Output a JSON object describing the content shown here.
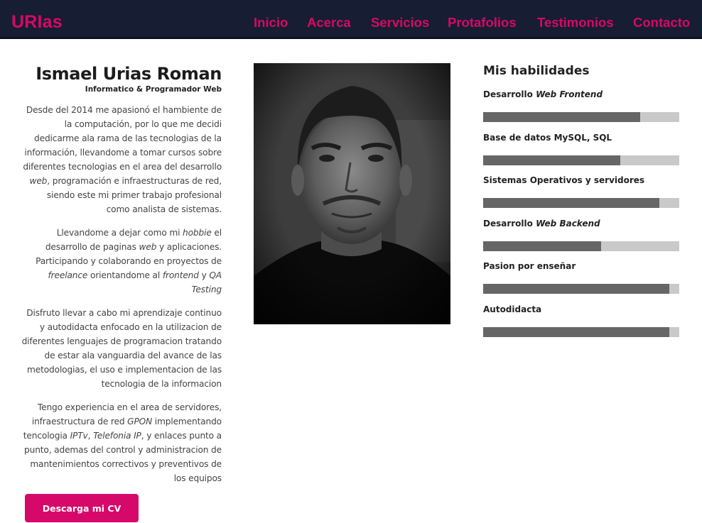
{
  "brand": "URIas",
  "nav": {
    "items": [
      {
        "label": "Inicio"
      },
      {
        "label": "Acerca"
      },
      {
        "label": "Servicios"
      },
      {
        "label": "Protafolios"
      },
      {
        "label": "Testimonios"
      },
      {
        "label": "Contacto"
      }
    ]
  },
  "about": {
    "name": "Ismael Urias Roman",
    "subtitle": "Informatico & Programador Web",
    "paragraphs": [
      [
        {
          "t": "Desde del 2014 me apasionó el hambiente de la computación, por lo que me decidi dedicarme ala rama de las tecnologias de la información, llevandome a tomar cursos sobre diferentes tecnologias en el area del desarrollo "
        },
        {
          "t": "web",
          "em": true
        },
        {
          "t": ", programación e infraestructuras de red, siendo este mi primer trabajo profesional como analista de sistemas."
        }
      ],
      [
        {
          "t": "Llevandome a dejar como mi "
        },
        {
          "t": "hobbie",
          "em": true
        },
        {
          "t": " el desarrollo de paginas "
        },
        {
          "t": "web",
          "em": true
        },
        {
          "t": " y aplicaciones. Participando y colaborando en proyectos de "
        },
        {
          "t": "freelance",
          "em": true
        },
        {
          "t": " orientandome al "
        },
        {
          "t": "frontend",
          "em": true
        },
        {
          "t": " y "
        },
        {
          "t": "QA Testing",
          "em": true
        }
      ],
      [
        {
          "t": "Disfruto llevar a cabo mi aprendizaje continuo y autodidacta enfocado en la utilizacion de diferentes lenguajes de programacion tratando de estar ala vanguardia del avance de las metodologias, el uso e implementacion de las tecnologia de la informacion"
        }
      ],
      [
        {
          "t": "Tengo experiencia en el area de servidores, infraestructura de red "
        },
        {
          "t": "GPON",
          "em": true
        },
        {
          "t": " implementando tencologia "
        },
        {
          "t": "IPTv",
          "em": true
        },
        {
          "t": ", "
        },
        {
          "t": "Telefonia IP",
          "em": true
        },
        {
          "t": ", y enlaces punto a punto, ademas del control y administracion de mantenimientos correctivos y preventivos de los equipos"
        }
      ]
    ],
    "cv_button": "Descarga mi CV"
  },
  "skills": {
    "title": "Mis habilidades",
    "items": [
      {
        "label": "Desarrollo ",
        "label_em": "Web Frontend",
        "level": 0.8
      },
      {
        "label": "Base de datos MySQL, SQL",
        "label_em": "",
        "level": 0.7
      },
      {
        "label": "Sistemas Operativos y servidores",
        "label_em": "",
        "level": 0.9
      },
      {
        "label": "Desarrollo ",
        "label_em": "Web Backend",
        "level": 0.6
      },
      {
        "label": "Pasion por enseñar",
        "label_em": "",
        "level": 0.95
      },
      {
        "label": "Autodidacta",
        "label_em": "",
        "level": 0.95
      }
    ]
  },
  "colors": {
    "accent": "#d6086a",
    "navbar": "#171d33",
    "bar_fill": "#666666",
    "bar_track": "#c9c9c9"
  }
}
